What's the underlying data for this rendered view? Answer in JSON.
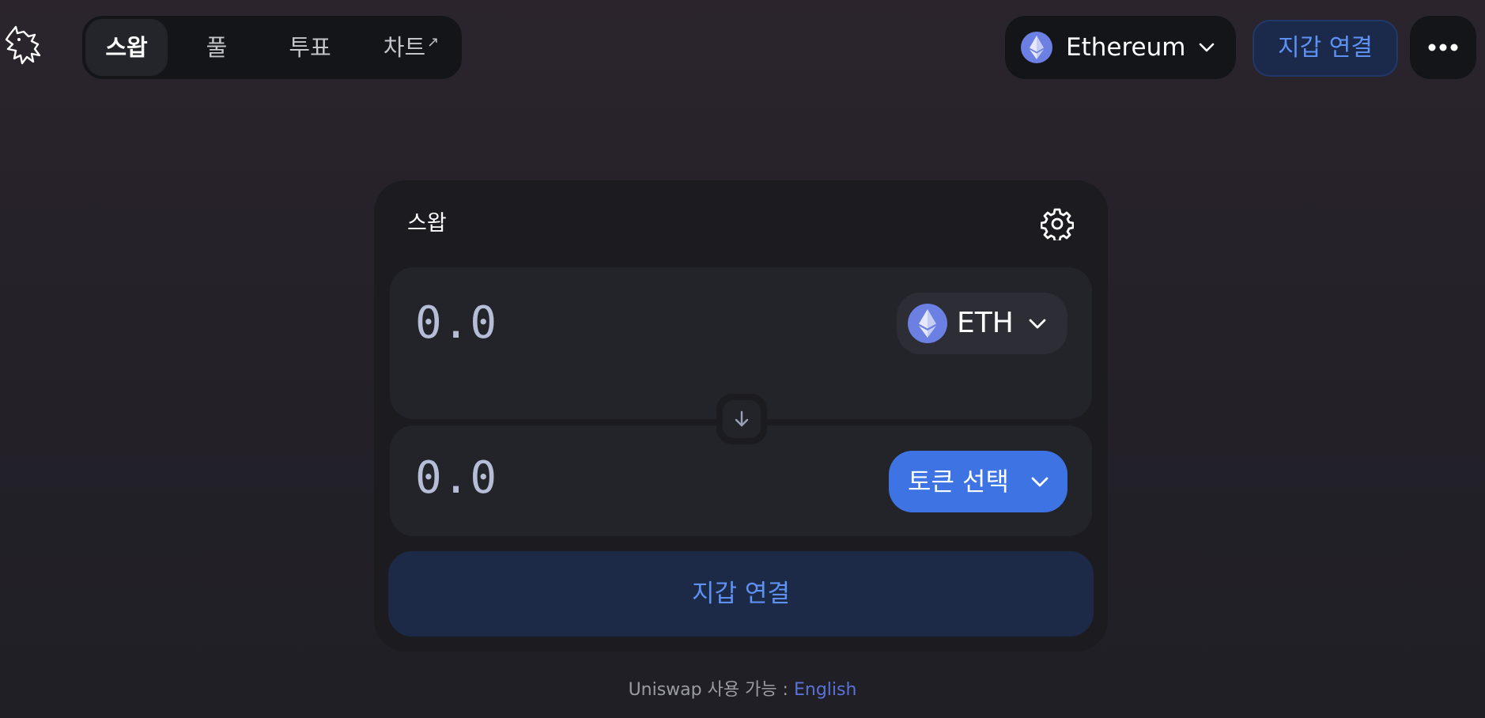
{
  "nav": {
    "logo_icon": "unicorn-logo-icon",
    "items": [
      {
        "label": "스왑",
        "active": true
      },
      {
        "label": "풀",
        "active": false
      },
      {
        "label": "투표",
        "active": false
      },
      {
        "label": "차트",
        "active": false,
        "external_icon": "↗"
      }
    ],
    "network": {
      "label": "Ethereum",
      "icon": "ethereum-icon"
    },
    "wallet_button": "지갑 연결",
    "more_icon": "more-dots-icon"
  },
  "swap": {
    "title": "스왑",
    "settings_icon": "gear-icon",
    "input": {
      "amount": "0.0",
      "token": "ETH",
      "token_icon": "ethereum-icon"
    },
    "output": {
      "amount": "0.0",
      "select_label": "토큰 선택"
    },
    "switch_icon": "arrow-down-icon",
    "connect_button": "지갑 연결"
  },
  "footer": {
    "text": "Uniswap 사용 가능 : ",
    "link": "English"
  },
  "colors": {
    "accent": "#3d73e2",
    "accent_text": "#5d91f3",
    "card_bg": "#1b1b20",
    "panel_bg": "#23242a"
  }
}
